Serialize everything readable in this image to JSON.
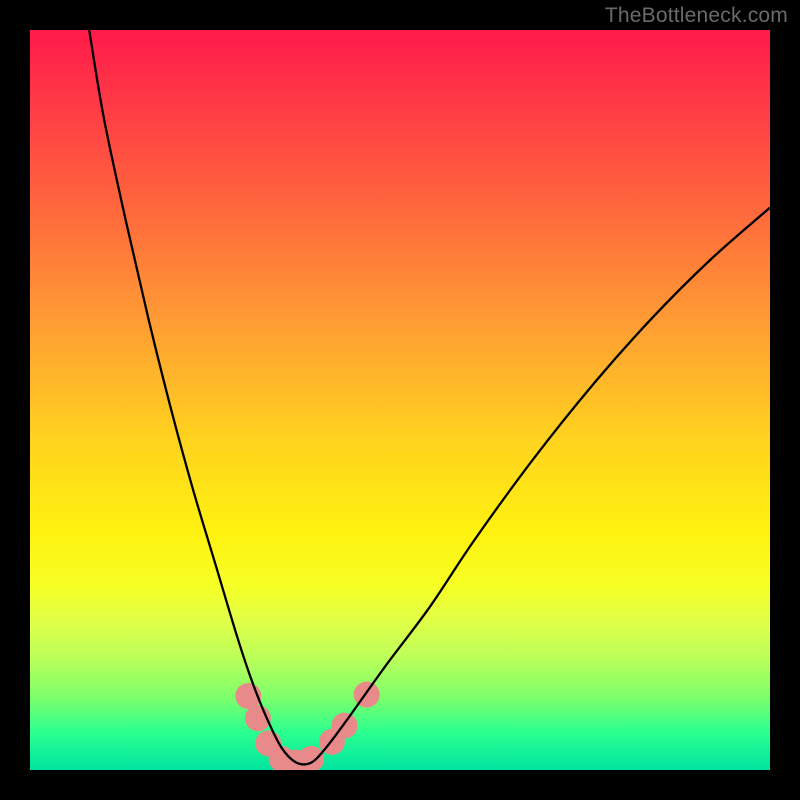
{
  "watermark": "TheBottleneck.com",
  "chart_data": {
    "type": "line",
    "title": "",
    "xlabel": "",
    "ylabel": "",
    "xlim": [
      0,
      100
    ],
    "ylim": [
      0,
      100
    ],
    "grid": false,
    "series": [
      {
        "name": "bottleneck-curve",
        "x": [
          8,
          10,
          13,
          16,
          19,
          22,
          25,
          28,
          30,
          32,
          34,
          36,
          38,
          40,
          43,
          48,
          54,
          60,
          68,
          76,
          84,
          92,
          100
        ],
        "y": [
          100,
          88,
          74,
          61,
          49,
          38,
          28,
          18,
          12,
          7,
          3,
          1,
          1,
          3,
          7,
          14,
          22,
          31,
          42,
          52,
          61,
          69,
          76
        ]
      }
    ],
    "markers": [
      {
        "x": 29.5,
        "y": 10.0
      },
      {
        "x": 30.8,
        "y": 7.0
      },
      {
        "x": 32.2,
        "y": 3.6
      },
      {
        "x": 34.0,
        "y": 1.5
      },
      {
        "x": 36.0,
        "y": 1.0
      },
      {
        "x": 38.0,
        "y": 1.5
      },
      {
        "x": 40.8,
        "y": 3.8
      },
      {
        "x": 42.5,
        "y": 6.0
      },
      {
        "x": 45.5,
        "y": 10.2
      }
    ],
    "marker_style": {
      "color": "#e88a8a",
      "radius": 13
    },
    "curve_style": {
      "color": "#000000",
      "width": 2.3
    },
    "background_gradient": {
      "top": "#ff1a4a",
      "bottom": "#00e4a0",
      "description": "red-orange-yellow-green vertical gradient"
    }
  }
}
